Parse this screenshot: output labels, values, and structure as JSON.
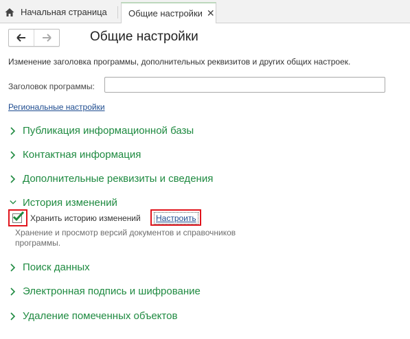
{
  "tabs": {
    "home_label": "Начальная страница",
    "active_label": "Общие настройки"
  },
  "page": {
    "title": "Общие настройки",
    "description": "Изменение заголовка программы, дополнительных реквизитов и других общих настроек."
  },
  "program_title": {
    "label": "Заголовок программы:",
    "value": ""
  },
  "regional_link": "Региональные настройки",
  "sections": {
    "publication": "Публикация информационной базы",
    "contacts": "Контактная информация",
    "extra_attrs": "Дополнительные реквизиты и сведения",
    "history": "История изменений",
    "search": "Поиск данных",
    "signature": "Электронная подпись и шифрование",
    "deletion": "Удаление помеченных объектов"
  },
  "history": {
    "checkbox_label": "Хранить историю изменений",
    "checked": true,
    "configure_link": "Настроить",
    "note": "Хранение и просмотр версий документов и справочников программы."
  },
  "colors": {
    "section_green": "#1e8a40",
    "link_blue": "#1d4b8f",
    "highlight_red": "#e0141c"
  }
}
